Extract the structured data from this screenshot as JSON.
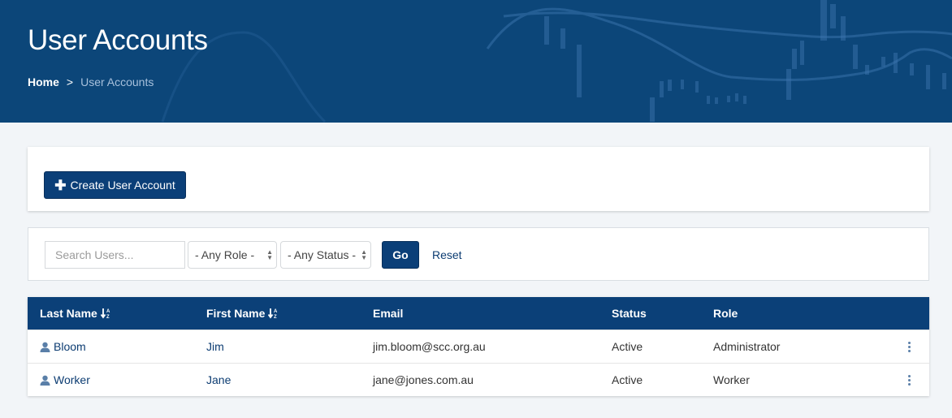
{
  "header": {
    "title": "User Accounts",
    "breadcrumb": [
      {
        "label": "Home",
        "link": true
      },
      {
        "label": ">",
        "link": false
      },
      {
        "label": "User Accounts",
        "link": false
      }
    ]
  },
  "actions": {
    "create_label": "Create User Account",
    "create_icon": "plus-icon"
  },
  "filters": {
    "search_placeholder": "Search Users...",
    "search_value": "",
    "role_selected": "- Any Role -",
    "status_selected": "- Any Status -",
    "go_label": "Go",
    "reset_label": "Reset"
  },
  "table": {
    "columns": [
      {
        "label": "Last Name",
        "sortable": true,
        "sort_icon": "sort-alpha-down-icon"
      },
      {
        "label": "First Name",
        "sortable": true,
        "sort_icon": "sort-alpha-down-icon"
      },
      {
        "label": "Email",
        "sortable": false
      },
      {
        "label": "Status",
        "sortable": false
      },
      {
        "label": "Role",
        "sortable": false
      }
    ],
    "rows": [
      {
        "last_name": "Bloom",
        "first_name": "Jim",
        "email": "jim.bloom@scc.org.au",
        "status": "Active",
        "role": "Administrator"
      },
      {
        "last_name": "Worker",
        "first_name": "Jane",
        "email": "jane@jones.com.au",
        "status": "Active",
        "role": "Worker"
      }
    ]
  },
  "colors": {
    "brand": "#0b4078",
    "header_bg": "#0c4679",
    "link": "#0c3c72",
    "page_bg": "#f2f5f8"
  }
}
